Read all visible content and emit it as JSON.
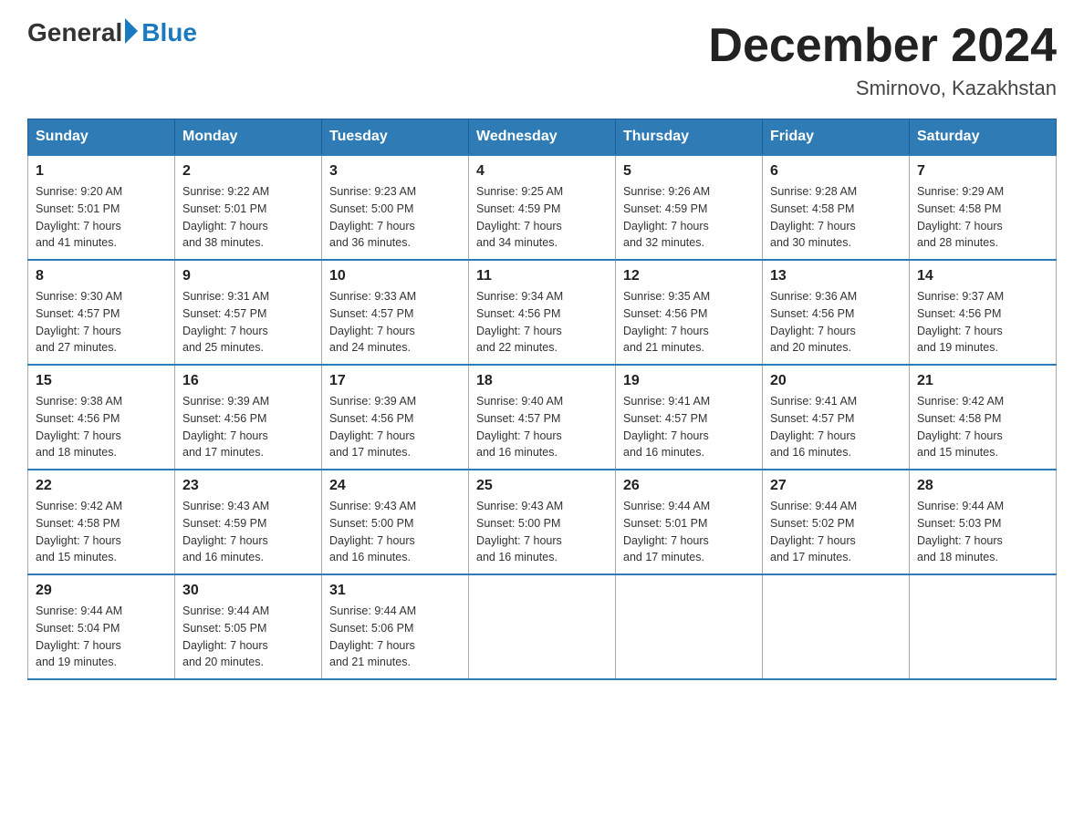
{
  "logo": {
    "general": "General",
    "blue": "Blue"
  },
  "title": "December 2024",
  "location": "Smirnovo, Kazakhstan",
  "days_of_week": [
    "Sunday",
    "Monday",
    "Tuesday",
    "Wednesday",
    "Thursday",
    "Friday",
    "Saturday"
  ],
  "weeks": [
    [
      {
        "day": "1",
        "sunrise": "9:20 AM",
        "sunset": "5:01 PM",
        "daylight": "7 hours and 41 minutes."
      },
      {
        "day": "2",
        "sunrise": "9:22 AM",
        "sunset": "5:01 PM",
        "daylight": "7 hours and 38 minutes."
      },
      {
        "day": "3",
        "sunrise": "9:23 AM",
        "sunset": "5:00 PM",
        "daylight": "7 hours and 36 minutes."
      },
      {
        "day": "4",
        "sunrise": "9:25 AM",
        "sunset": "4:59 PM",
        "daylight": "7 hours and 34 minutes."
      },
      {
        "day": "5",
        "sunrise": "9:26 AM",
        "sunset": "4:59 PM",
        "daylight": "7 hours and 32 minutes."
      },
      {
        "day": "6",
        "sunrise": "9:28 AM",
        "sunset": "4:58 PM",
        "daylight": "7 hours and 30 minutes."
      },
      {
        "day": "7",
        "sunrise": "9:29 AM",
        "sunset": "4:58 PM",
        "daylight": "7 hours and 28 minutes."
      }
    ],
    [
      {
        "day": "8",
        "sunrise": "9:30 AM",
        "sunset": "4:57 PM",
        "daylight": "7 hours and 27 minutes."
      },
      {
        "day": "9",
        "sunrise": "9:31 AM",
        "sunset": "4:57 PM",
        "daylight": "7 hours and 25 minutes."
      },
      {
        "day": "10",
        "sunrise": "9:33 AM",
        "sunset": "4:57 PM",
        "daylight": "7 hours and 24 minutes."
      },
      {
        "day": "11",
        "sunrise": "9:34 AM",
        "sunset": "4:56 PM",
        "daylight": "7 hours and 22 minutes."
      },
      {
        "day": "12",
        "sunrise": "9:35 AM",
        "sunset": "4:56 PM",
        "daylight": "7 hours and 21 minutes."
      },
      {
        "day": "13",
        "sunrise": "9:36 AM",
        "sunset": "4:56 PM",
        "daylight": "7 hours and 20 minutes."
      },
      {
        "day": "14",
        "sunrise": "9:37 AM",
        "sunset": "4:56 PM",
        "daylight": "7 hours and 19 minutes."
      }
    ],
    [
      {
        "day": "15",
        "sunrise": "9:38 AM",
        "sunset": "4:56 PM",
        "daylight": "7 hours and 18 minutes."
      },
      {
        "day": "16",
        "sunrise": "9:39 AM",
        "sunset": "4:56 PM",
        "daylight": "7 hours and 17 minutes."
      },
      {
        "day": "17",
        "sunrise": "9:39 AM",
        "sunset": "4:56 PM",
        "daylight": "7 hours and 17 minutes."
      },
      {
        "day": "18",
        "sunrise": "9:40 AM",
        "sunset": "4:57 PM",
        "daylight": "7 hours and 16 minutes."
      },
      {
        "day": "19",
        "sunrise": "9:41 AM",
        "sunset": "4:57 PM",
        "daylight": "7 hours and 16 minutes."
      },
      {
        "day": "20",
        "sunrise": "9:41 AM",
        "sunset": "4:57 PM",
        "daylight": "7 hours and 16 minutes."
      },
      {
        "day": "21",
        "sunrise": "9:42 AM",
        "sunset": "4:58 PM",
        "daylight": "7 hours and 15 minutes."
      }
    ],
    [
      {
        "day": "22",
        "sunrise": "9:42 AM",
        "sunset": "4:58 PM",
        "daylight": "7 hours and 15 minutes."
      },
      {
        "day": "23",
        "sunrise": "9:43 AM",
        "sunset": "4:59 PM",
        "daylight": "7 hours and 16 minutes."
      },
      {
        "day": "24",
        "sunrise": "9:43 AM",
        "sunset": "5:00 PM",
        "daylight": "7 hours and 16 minutes."
      },
      {
        "day": "25",
        "sunrise": "9:43 AM",
        "sunset": "5:00 PM",
        "daylight": "7 hours and 16 minutes."
      },
      {
        "day": "26",
        "sunrise": "9:44 AM",
        "sunset": "5:01 PM",
        "daylight": "7 hours and 17 minutes."
      },
      {
        "day": "27",
        "sunrise": "9:44 AM",
        "sunset": "5:02 PM",
        "daylight": "7 hours and 17 minutes."
      },
      {
        "day": "28",
        "sunrise": "9:44 AM",
        "sunset": "5:03 PM",
        "daylight": "7 hours and 18 minutes."
      }
    ],
    [
      {
        "day": "29",
        "sunrise": "9:44 AM",
        "sunset": "5:04 PM",
        "daylight": "7 hours and 19 minutes."
      },
      {
        "day": "30",
        "sunrise": "9:44 AM",
        "sunset": "5:05 PM",
        "daylight": "7 hours and 20 minutes."
      },
      {
        "day": "31",
        "sunrise": "9:44 AM",
        "sunset": "5:06 PM",
        "daylight": "7 hours and 21 minutes."
      },
      null,
      null,
      null,
      null
    ]
  ],
  "labels": {
    "sunrise": "Sunrise:",
    "sunset": "Sunset:",
    "daylight": "Daylight:"
  }
}
